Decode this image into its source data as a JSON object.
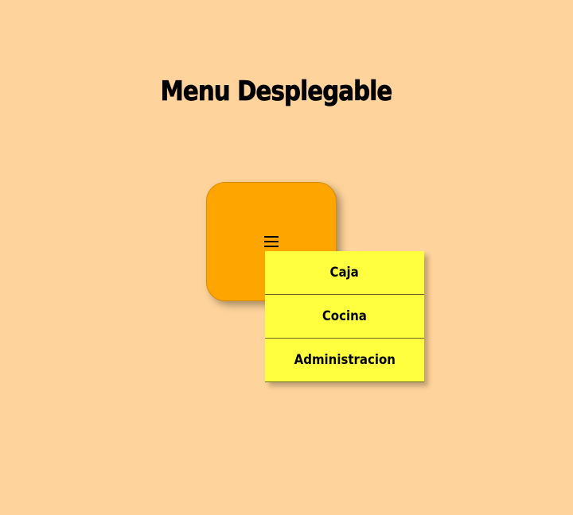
{
  "page": {
    "title": "Menu Desplegable",
    "background_color": "#ffd49c"
  },
  "menu_card": {
    "color": "#ffa500",
    "toggle_icon": "hamburger-icon"
  },
  "dropdown": {
    "color": "#ffff40",
    "items": [
      {
        "label": "Caja"
      },
      {
        "label": "Cocina"
      },
      {
        "label": "Administracion"
      }
    ]
  }
}
